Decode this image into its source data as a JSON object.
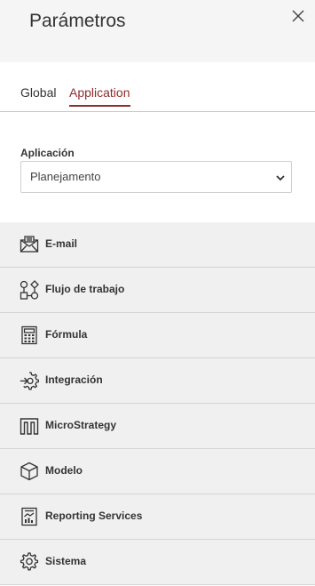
{
  "header": {
    "title": "Parámetros"
  },
  "tabs": [
    {
      "label": "Global",
      "active": false
    },
    {
      "label": "Application",
      "active": true
    }
  ],
  "form": {
    "field_label": "Aplicación",
    "select_value": "Planejamento"
  },
  "menu": {
    "items": [
      {
        "label": "E-mail",
        "icon": "envelope-icon"
      },
      {
        "label": "Flujo de trabajo",
        "icon": "workflow-icon"
      },
      {
        "label": "Fórmula",
        "icon": "calculator-icon"
      },
      {
        "label": "Integración",
        "icon": "gear-arrow-icon"
      },
      {
        "label": "MicroStrategy",
        "icon": "microstrategy-icon"
      },
      {
        "label": "Modelo",
        "icon": "cube-icon"
      },
      {
        "label": "Reporting Services",
        "icon": "report-chart-icon"
      },
      {
        "label": "Sistema",
        "icon": "gear-icon"
      }
    ]
  },
  "colors": {
    "accent": "#8b2e2e",
    "header_bg": "#f5f5f5",
    "menu_bg": "#f0f0f0"
  }
}
